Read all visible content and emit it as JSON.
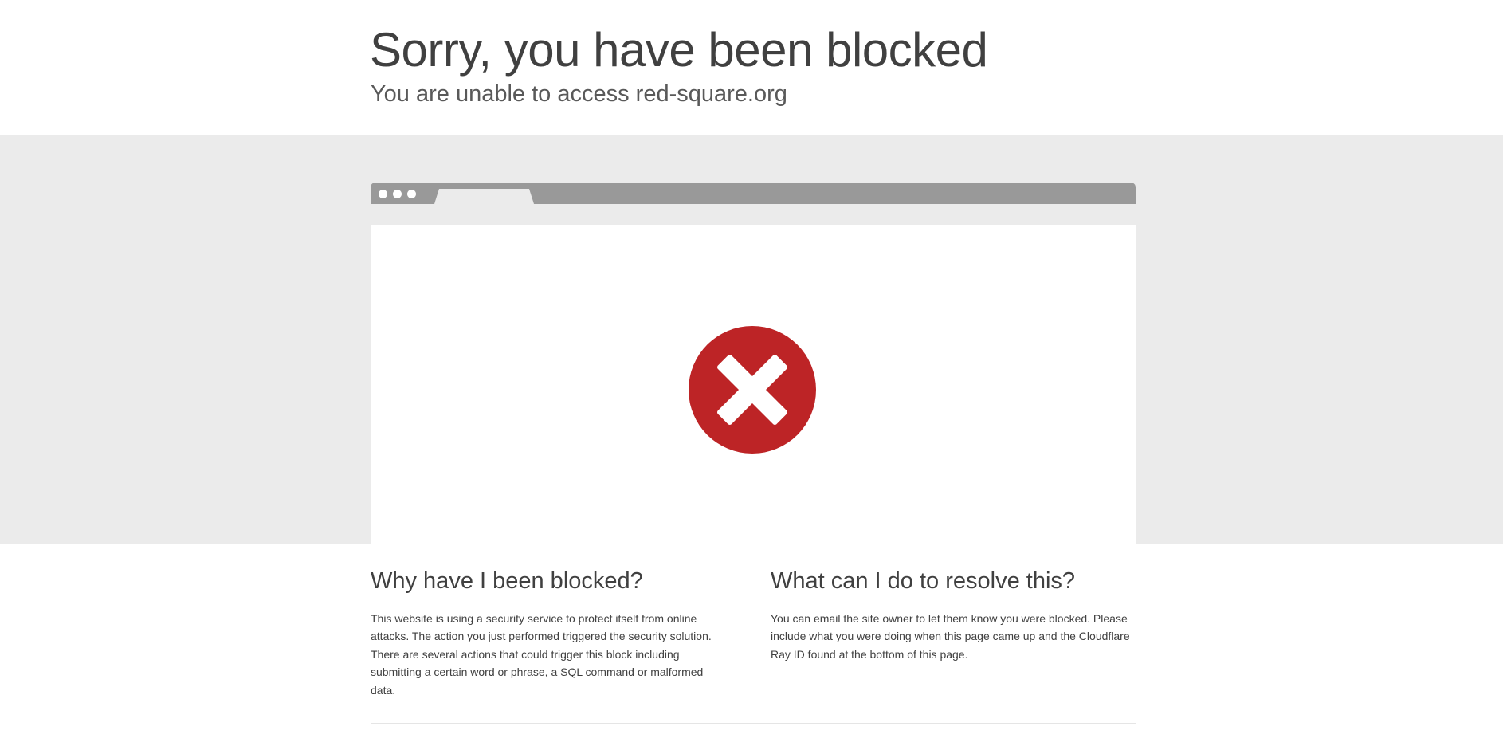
{
  "header": {
    "title": "Sorry, you have been blocked",
    "subtitle": "You are unable to access red-square.org"
  },
  "illustration": {
    "icon": "blocked-x-icon",
    "icon_color": "#bd2426",
    "browser_bar_color": "#999999"
  },
  "why": {
    "heading": "Why have I been blocked?",
    "body": "This website is using a security service to protect itself from online attacks. The action you just performed triggered the security solution. There are several actions that could trigger this block including submitting a certain word or phrase, a SQL command or malformed data."
  },
  "resolve": {
    "heading": "What can I do to resolve this?",
    "body": "You can email the site owner to let them know you were blocked. Please include what you were doing when this page came up and the Cloudflare Ray ID found at the bottom of this page."
  }
}
